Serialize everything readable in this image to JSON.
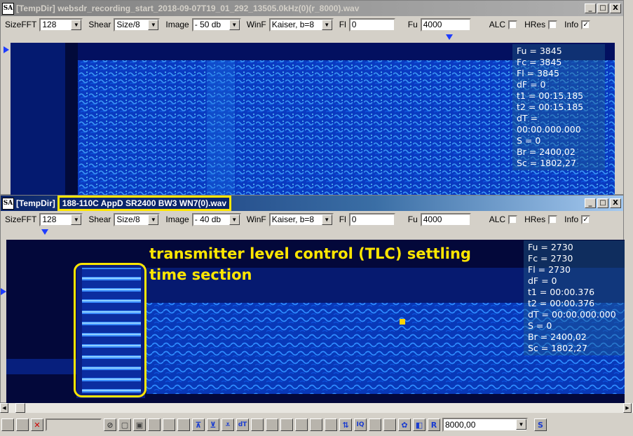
{
  "app_icon": "SA",
  "window1": {
    "title": "[TempDir] websdr_recording_start_2018-09-07T19_01_292_13505.0kHz(0)(r_8000).wav",
    "toolbar": {
      "sizefft_label": "SizeFFT",
      "sizefft_value": "128",
      "shear_label": "Shear",
      "shear_value": "Size/8",
      "image_label": "Image",
      "image_value": "- 50 db",
      "winf_label": "WinF",
      "winf_value": "Kaiser, b=8",
      "fl_label": "Fl",
      "fl_value": "0",
      "fu_label": "Fu",
      "fu_value": "4000",
      "alc_label": "ALC",
      "hres_label": "HRes",
      "info_label": "Info",
      "info_checked": "✓"
    },
    "info_lines": [
      "Fu = 3845",
      "Fc = 3845",
      "Fl = 3845",
      "dF = 0",
      "t1 = 00:15.185",
      "t2 = 00:15.185",
      "dT = 00:00.000.000",
      "S = 0",
      "Br = 2400,02",
      "Sc = 1802,27"
    ]
  },
  "window2": {
    "title_prefix": "[TempDir]",
    "title_file": "188-110C AppD SR2400 BW3 WN7(0).wav",
    "toolbar": {
      "sizefft_label": "SizeFFT",
      "sizefft_value": "128",
      "shear_label": "Shear",
      "shear_value": "Size/8",
      "image_label": "Image",
      "image_value": "- 40 db",
      "winf_label": "WinF",
      "winf_value": "Kaiser, b=8",
      "fl_label": "Fl",
      "fl_value": "0",
      "fu_label": "Fu",
      "fu_value": "4000",
      "alc_label": "ALC",
      "hres_label": "HRes",
      "info_label": "Info",
      "info_checked": "✓"
    },
    "annotation_line1": "transmitter level control (TLC) settling",
    "annotation_line2": "time section",
    "info_lines": [
      "Fu = 2730",
      "Fc = 2730",
      "Fl = 2730",
      "dF = 0",
      "t1 = 00:00.376",
      "t2 = 00:00.376",
      "dT = 00:00.000.000",
      "S = 0",
      "Br = 2400,02",
      "Sc = 1802,27"
    ]
  },
  "win_buttons": {
    "minimize": "_",
    "maximize": "□",
    "close": "X"
  },
  "bottom_toolbar": {
    "rate_value": "8000,00",
    "s_button": "S",
    "r_button": "R",
    "dt_button": "dT",
    "iq_button": "IQ"
  }
}
